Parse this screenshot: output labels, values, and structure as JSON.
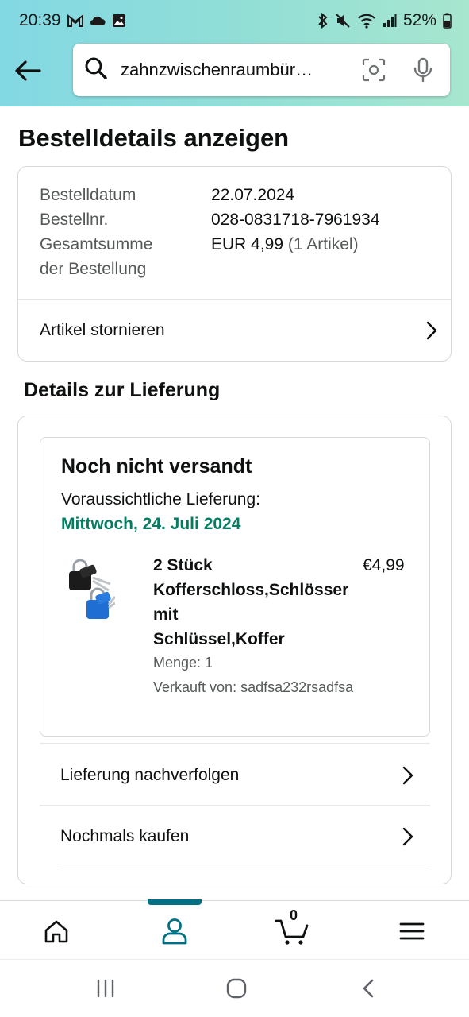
{
  "statusbar": {
    "time": "20:39",
    "battery": "52%"
  },
  "search": {
    "query": "zahnzwischenraumbür…"
  },
  "page": {
    "title": "Bestelldetails anzeigen"
  },
  "order_summary": {
    "date_label": "Bestelldatum",
    "date_value": "22.07.2024",
    "number_label": "Bestellnr.",
    "number_value": "028-0831718-7961934",
    "total_label_line1": "Gesamtsumme",
    "total_label_line2": "der Bestellung",
    "total_value": "EUR 4,99",
    "total_items": "(1 Artikel)",
    "cancel_label": "Artikel stornieren"
  },
  "delivery": {
    "section_title": "Details zur Lieferung",
    "status": "Noch nicht versandt",
    "expected_label": "Voraussichtliche Lieferung:",
    "expected_date": "Mittwoch, 24. Juli 2024",
    "product": {
      "title_lines": [
        "2 Stück",
        "Kofferschloss,Schlösser",
        "mit",
        "Schlüssel,Koffer"
      ],
      "price": "€4,99",
      "quantity": "Menge: 1",
      "seller": "Verkauft von: sadfsa232rsadfsa"
    },
    "track_label": "Lieferung nachverfolgen",
    "buy_again_label": "Nochmals kaufen"
  },
  "bottom_nav": {
    "cart_count": "0",
    "active": "account",
    "accent_color": "#007185"
  },
  "colors": {
    "delivery_green": "#067d62",
    "header_gradient_start": "#82d8e3",
    "header_gradient_end": "#a7e6cf"
  }
}
